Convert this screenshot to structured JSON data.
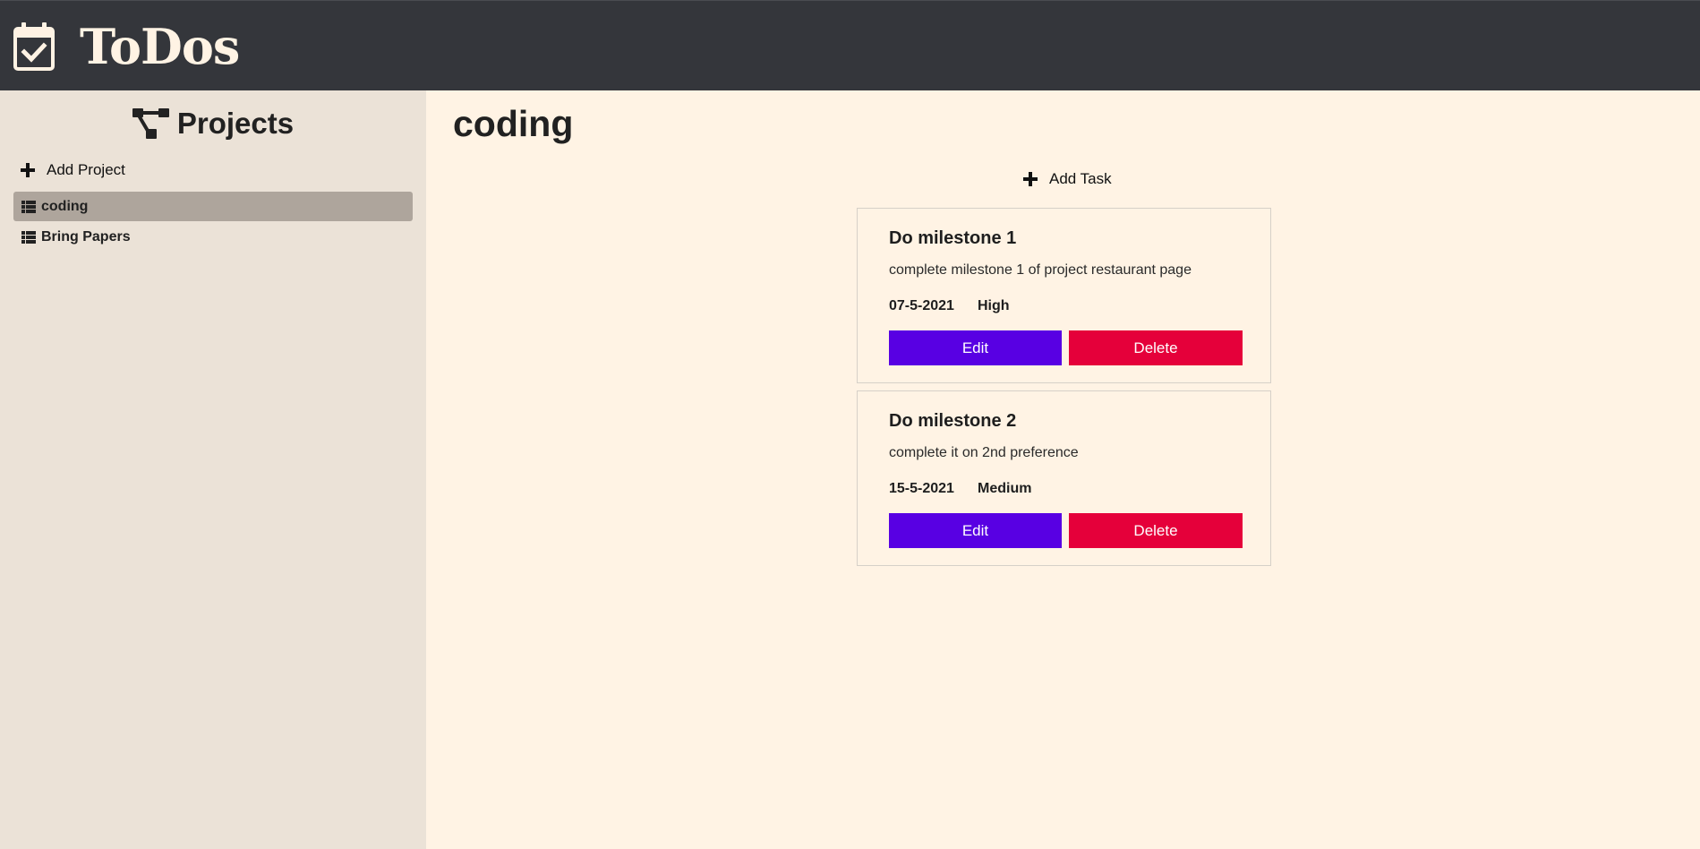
{
  "header": {
    "app_title": "ToDos",
    "icon": "calendar-check-icon"
  },
  "sidebar": {
    "title": "Projects",
    "title_icon": "project-diagram-icon",
    "add_project_label": "Add Project",
    "projects": [
      {
        "name": "coding",
        "active": true,
        "icon": "list-icon"
      },
      {
        "name": "Bring Papers",
        "active": false,
        "icon": "list-icon"
      }
    ]
  },
  "main": {
    "project_title": "coding",
    "add_task_label": "Add Task",
    "tasks": [
      {
        "title": "Do milestone 1",
        "description": "complete milestone 1 of project restaurant page",
        "due_date": "07-5-2021",
        "priority": "High",
        "edit_label": "Edit",
        "delete_label": "Delete"
      },
      {
        "title": "Do milestone 2",
        "description": "complete it on 2nd preference",
        "due_date": "15-5-2021",
        "priority": "Medium",
        "edit_label": "Edit",
        "delete_label": "Delete"
      }
    ]
  },
  "colors": {
    "header_bg": "#34363b",
    "sidebar_bg": "#ebe2d7",
    "main_bg": "#fff3e4",
    "active_project_bg": "#aea59c",
    "edit_button": "#5800e3",
    "delete_button": "#e5003a"
  }
}
